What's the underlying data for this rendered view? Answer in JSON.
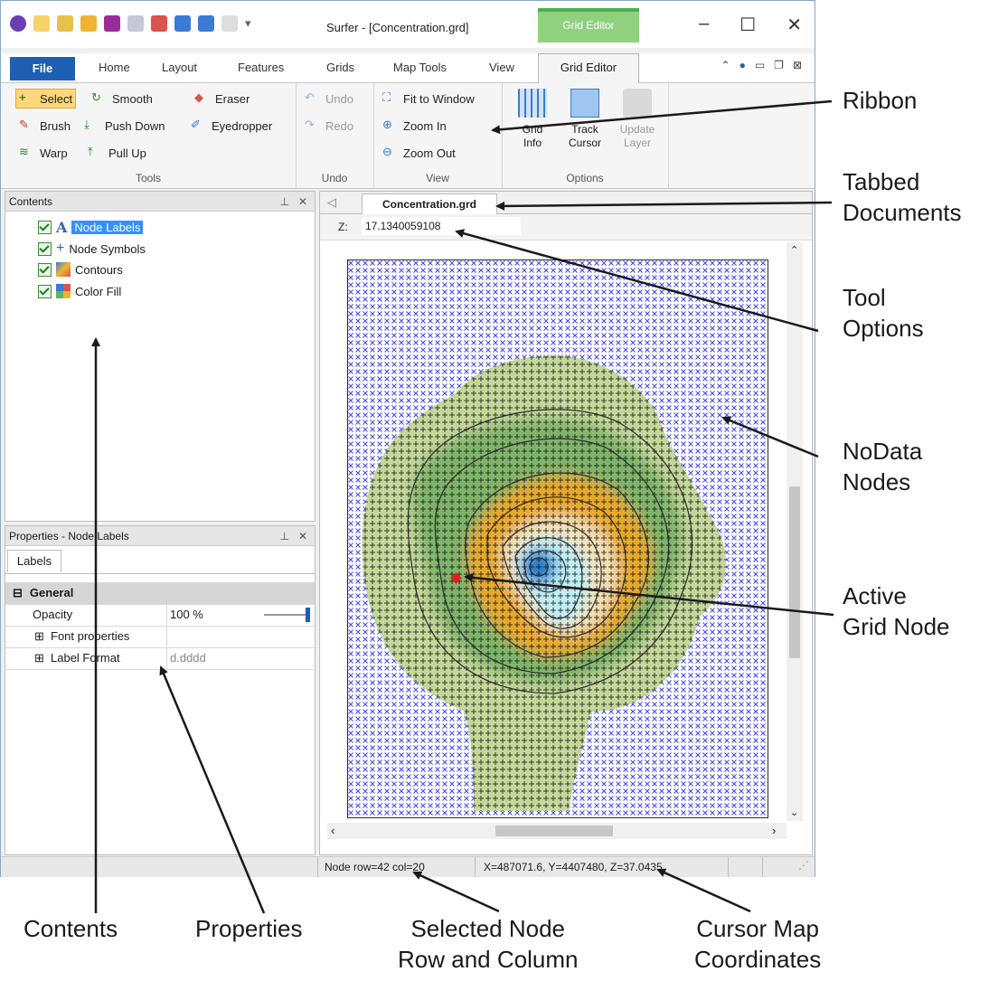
{
  "window": {
    "title": "Surfer - [Concentration.grd]",
    "context_tab_title": "Grid Editor",
    "controls": [
      "–",
      "☐",
      "✕"
    ]
  },
  "ribbon_tabs": {
    "file": "File",
    "tabs": [
      "Home",
      "Layout",
      "Features",
      "Grids",
      "Map Tools",
      "View"
    ],
    "active": "Grid Editor"
  },
  "ribbon": {
    "tools": {
      "select": "Select",
      "smooth": "Smooth",
      "eraser": "Eraser",
      "brush": "Brush",
      "push_down": "Push Down",
      "eyedropper": "Eyedropper",
      "warp": "Warp",
      "pull_up": "Pull Up",
      "label": "Tools"
    },
    "undo": {
      "undo": "Undo",
      "redo": "Redo",
      "label": "Undo"
    },
    "view": {
      "fit": "Fit to Window",
      "zoom_in": "Zoom In",
      "zoom_out": "Zoom Out",
      "label": "View"
    },
    "options": {
      "grid_info_1": "Grid",
      "grid_info_2": "Info",
      "track_1": "Track",
      "track_2": "Cursor",
      "update_1": "Update",
      "update_2": "Layer",
      "label": "Options"
    }
  },
  "contents": {
    "title": "Contents",
    "items": [
      "Node Labels",
      "Node Symbols",
      "Contours",
      "Color Fill"
    ]
  },
  "properties": {
    "title": "Properties - Node Labels",
    "tab": "Labels",
    "section": "General",
    "rows": [
      {
        "name": "Opacity",
        "value": "100 %"
      },
      {
        "name": "Font properties",
        "value": ""
      },
      {
        "name": "Label Format",
        "value": "d.dddd"
      }
    ]
  },
  "document": {
    "tab": "Concentration.grd",
    "z_label": "Z:",
    "z_value": "17.1340059108"
  },
  "status": {
    "node": "Node row=42 col=20",
    "coords": "X=487071.6, Y=4407480, Z=37.0435"
  },
  "annotations": {
    "ribbon": "Ribbon",
    "tabbed_1": "Tabbed",
    "tabbed_2": "Documents",
    "tool_1": "Tool",
    "tool_2": "Options",
    "nodata_1": "NoData",
    "nodata_2": "Nodes",
    "active_1": "Active",
    "active_2": "Grid Node",
    "contents": "Contents",
    "properties": "Properties",
    "selected_1": "Selected Node",
    "selected_2": "Row and Column",
    "cursor_1": "Cursor Map",
    "cursor_2": "Coordinates"
  },
  "colors": {
    "file_tab": "#1f5fb3",
    "context_tab": "#8fd17f",
    "nodata_x": "#3b3bff",
    "selection": "#3390ff"
  }
}
